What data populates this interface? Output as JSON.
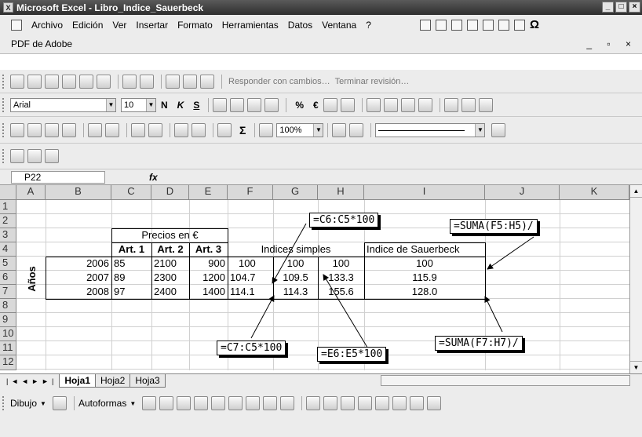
{
  "window": {
    "title": "Microsoft Excel - Libro_Indice_Sauerbeck",
    "app_icon": "excel-icon",
    "buttons": [
      "_",
      "□",
      "×"
    ]
  },
  "menu": {
    "items": [
      "Archivo",
      "Edición",
      "Ver",
      "Insertar",
      "Formato",
      "Herramientas",
      "Datos",
      "Ventana",
      "?"
    ],
    "pdf_menu": "PDF de Adobe",
    "doc_buttons": "_ ▫ ×"
  },
  "review_toolbar": {
    "reply": "Responder con cambios…",
    "end_review": "Terminar revisión…"
  },
  "format_toolbar": {
    "font": "Arial",
    "size": "10",
    "bold": "N",
    "italic": "K",
    "underline": "S",
    "percent": "%",
    "euro": "€"
  },
  "standard_toolbar": {
    "zoom": "100%",
    "sigma": "Σ"
  },
  "formula_bar": {
    "name_box": "P22",
    "fx": "fx",
    "content": ""
  },
  "columns": [
    "A",
    "B",
    "C",
    "D",
    "E",
    "F",
    "G",
    "H",
    "I",
    "J",
    "K"
  ],
  "rows": [
    "1",
    "2",
    "3",
    "4",
    "5",
    "6",
    "7",
    "8",
    "9",
    "10",
    "11",
    "12"
  ],
  "sheet": {
    "precios_header": "Precios en €",
    "art_headers": [
      "Art. 1",
      "Art. 2",
      "Art. 3"
    ],
    "indices_header": "Indices simples",
    "sauerbeck_header": "Indice de Sauerbeck",
    "years_label": "Años",
    "data": [
      {
        "year": "2006",
        "a1": "85",
        "a2": "2100",
        "a3": "900",
        "f": "100",
        "g": "100",
        "h": "100",
        "i": "100"
      },
      {
        "year": "2007",
        "a1": "89",
        "a2": "2300",
        "a3": "1200",
        "f": "104.7",
        "g": "109.5",
        "h": "133.3",
        "i": "115.9"
      },
      {
        "year": "2008",
        "a1": "97",
        "a2": "2400",
        "a3": "1400",
        "f": "114.1",
        "g": "114.3",
        "h": "155.6",
        "i": "128.0"
      }
    ]
  },
  "annotations": {
    "c6": "=C6:C5*100",
    "suma5": "=SUMA(F5:H5)/",
    "c7": "=C7:C5*100",
    "e6": "=E6:E5*100",
    "suma7": "=SUMA(F7:H7)/"
  },
  "sheet_tabs": [
    "Hoja1",
    "Hoja2",
    "Hoja3"
  ],
  "drawing_toolbar": {
    "dibujo": "Dibujo",
    "autoformas": "Autoformas"
  }
}
